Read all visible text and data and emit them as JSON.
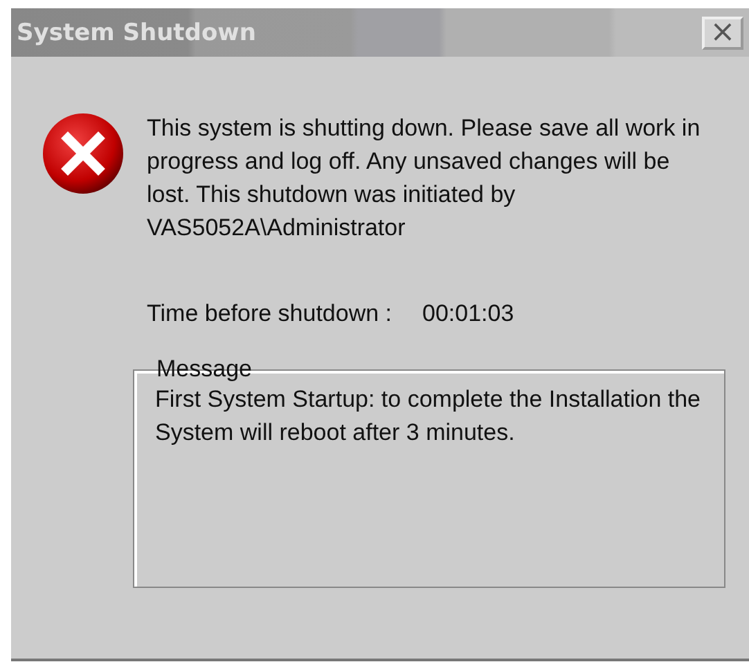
{
  "window": {
    "title": "System Shutdown",
    "close": "×"
  },
  "message": "This system is shutting down. Please save all work in progress and log off. Any unsaved changes will be lost. This shutdown was initiated by VAS5052A\\Administrator",
  "time_label": "Time before shutdown :",
  "time_value": "00:01:03",
  "group": {
    "legend": "Message",
    "text": "First System Startup: to complete the Installation the System will reboot after 3 minutes."
  }
}
